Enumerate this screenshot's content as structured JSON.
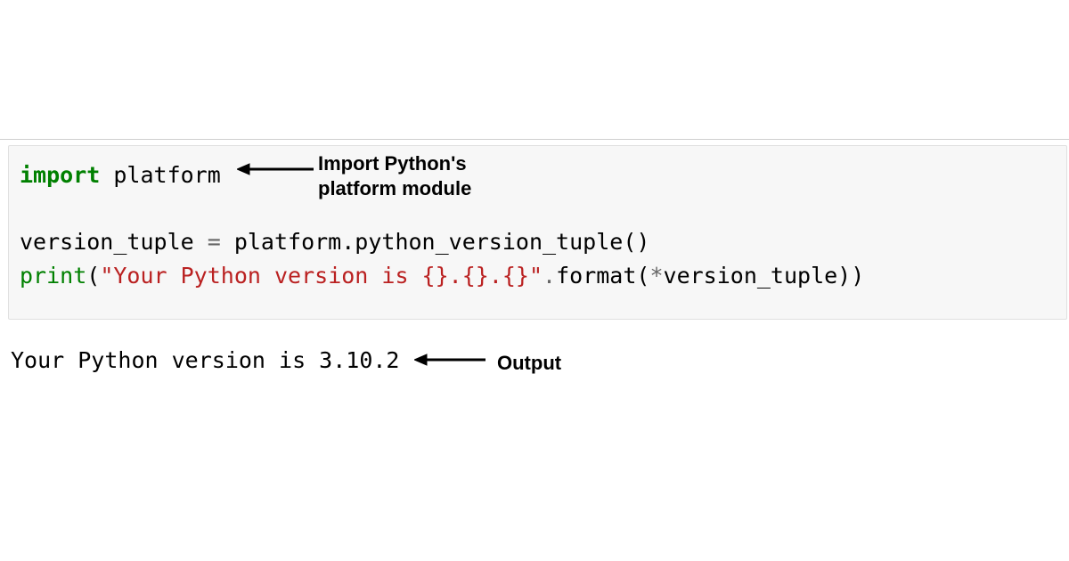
{
  "code": {
    "line1": {
      "keyword": "import",
      "space": " ",
      "module": "platform"
    },
    "line2_empty": "",
    "line3": {
      "varname": "version_tuple",
      "eq": " = ",
      "rhs": "platform.python_version_tuple()"
    },
    "line4": {
      "func": "print",
      "open": "(",
      "string": "\"Your Python version is {}.{}.{}\"",
      "dot": ".",
      "method": "format(",
      "star": "*",
      "arg": "version_tuple))"
    }
  },
  "annotations": {
    "import": "Import Python's\nplatform module",
    "output": "Output"
  },
  "output": "Your Python version is 3.10.2"
}
